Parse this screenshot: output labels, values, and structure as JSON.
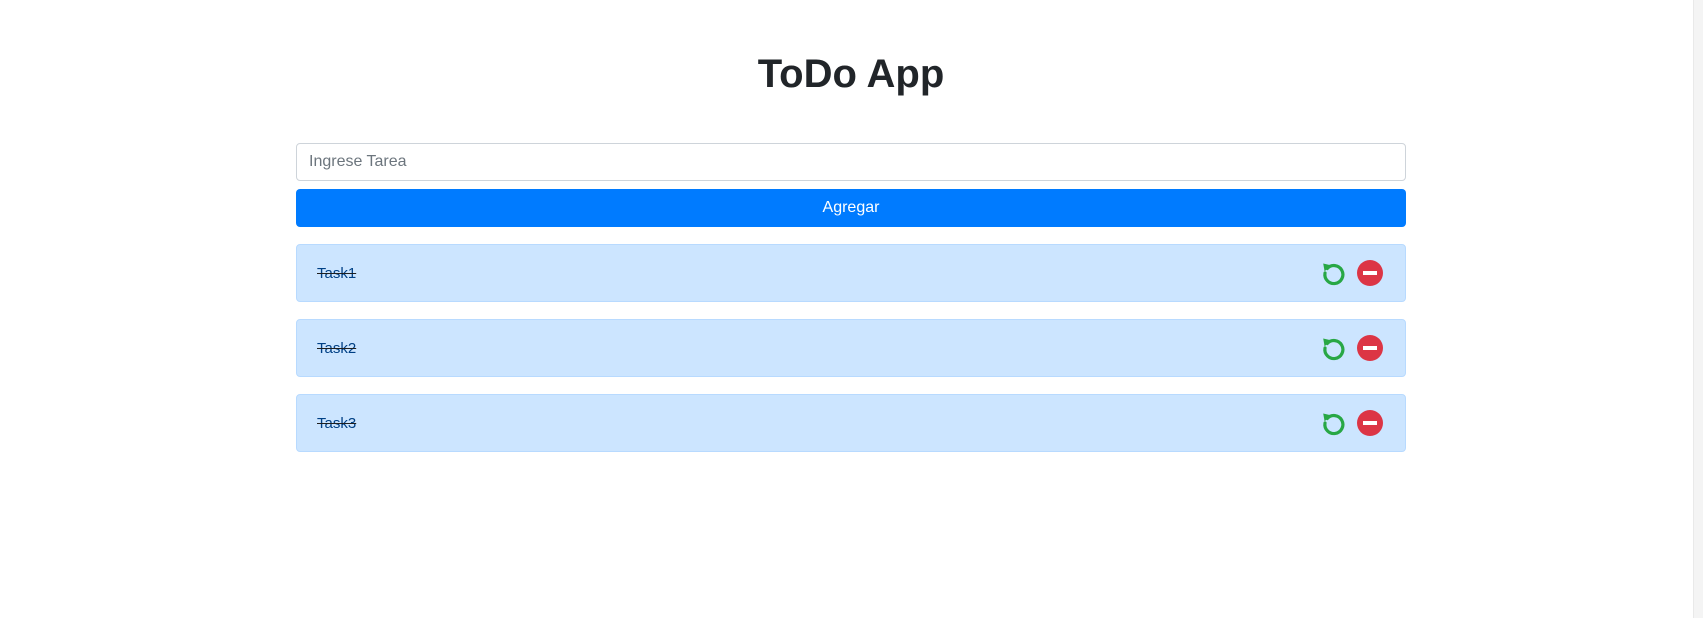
{
  "app": {
    "title": "ToDo App"
  },
  "form": {
    "input_value": "",
    "input_placeholder": "Ingrese Tarea",
    "add_button_label": "Agregar"
  },
  "tasks": [
    {
      "label": "Task1",
      "completed": true
    },
    {
      "label": "Task2",
      "completed": true
    },
    {
      "label": "Task3",
      "completed": true
    }
  ],
  "icons": {
    "undo": "undo-icon",
    "delete": "minus-circle-icon"
  },
  "colors": {
    "primary": "#007bff",
    "task_background": "#cce5ff",
    "task_border": "#b8daff",
    "undo": "#28a745",
    "delete": "#dc3545"
  }
}
